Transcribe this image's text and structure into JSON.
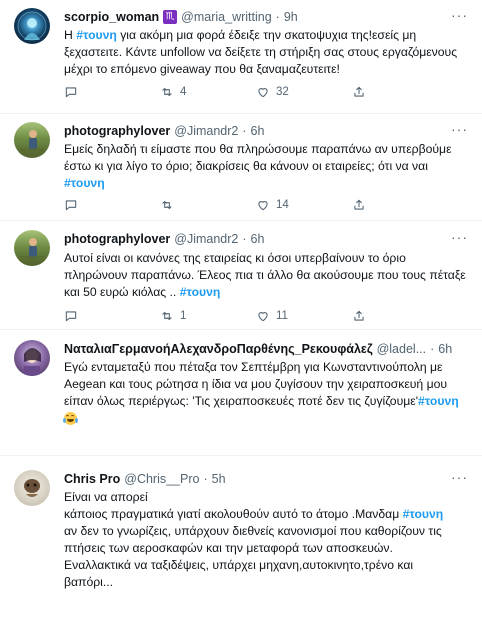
{
  "tweets": [
    {
      "name": "scorpio_woman",
      "zodiac": "♏",
      "handle": "@maria_writting",
      "time": "9h",
      "lines": [
        [
          "Η ",
          "#τουνη",
          " για ακόμη μια φορά έδειξε την σκατοψυχια της!εσείς μη"
        ],
        [
          "ξεχαστειτε. Κάντε unfollow να δείξετε τη στήριξη σας στους εργαζόμενους"
        ],
        [
          "μέχρι το επόμενο giveaway που θα ξαναμαζευτειτε!"
        ]
      ],
      "replies": "",
      "retweets": "4",
      "likes": "32"
    },
    {
      "name": "photographylover",
      "handle": "@Jimandr2",
      "time": "6h",
      "lines": [
        [
          "Εμείς δηλαδή τι είμαστε που θα πληρώσουμε παραπάνω αν υπερβούμε"
        ],
        [
          "έστω κι για λίγο το όριο; διακρίσεις θα κάνουν οι εταιρείες; ότι να ναι"
        ],
        [
          "",
          "#τουνη",
          ""
        ]
      ],
      "replies": "",
      "retweets": "",
      "likes": "14"
    },
    {
      "name": "photographylover",
      "handle": "@Jimandr2",
      "time": "6h",
      "lines": [
        [
          "Αυτοί είναι οι κανόνες της εταιρείας κι όσοι υπερβαίνουν το όριο"
        ],
        [
          "πληρώνουν παραπάνω.  Έλεος πια τι άλλο θα ακούσουμε που τους πέταξε"
        ],
        [
          "και 50 ευρώ κιόλας .. ",
          "#τουνη",
          ""
        ]
      ],
      "replies": "",
      "retweets": "1",
      "likes": "11"
    },
    {
      "name": "ΝαταλιαΓερμανοήΑλεχανδροΠαρθένης_Ρεκουφάλεζ",
      "handle": "@ladel...",
      "time": "6h",
      "lines": [
        [
          "Εγώ ενταμεταξύ που πέταξα τον Σεπτέμβρη για Κωνσταντινούπολη με"
        ],
        [
          "Aegean και τους ρώτησα η ίδια να μου ζυγίσουν την χειραποσκευή μου"
        ],
        [
          "είπαν όλως περιέργως: 'Τις χειραποσκευές ποτέ δεν τις ζυγίζουμε'",
          "#τουνη",
          ""
        ]
      ],
      "replies": "",
      "retweets": "",
      "likes": ""
    },
    {
      "name": "Chris Pro",
      "handle": "@Chris__Pro",
      "time": "5h",
      "lines": [
        [
          "Είναι να απορεί"
        ],
        [
          "κάποιος πραγματικά γιατί ακολουθούν αυτό το άτομο .Μανδαμ ",
          "#τουνη",
          ""
        ],
        [
          "αν δεν το γνωρίζεις, υπάρχουν διεθνείς κανονισμοί που καθορίζουν τις"
        ],
        [
          "πτήσεις  των αεροσκαφών και την μεταφορά των αποσκευών."
        ],
        [
          "Εναλλακτικά να ταξιδέψεις, υπάρχει μηχανη,αυτοκινητο,τρένο και"
        ],
        [
          "βαπόρι..."
        ]
      ],
      "replies": "",
      "retweets": "",
      "likes": ""
    }
  ]
}
